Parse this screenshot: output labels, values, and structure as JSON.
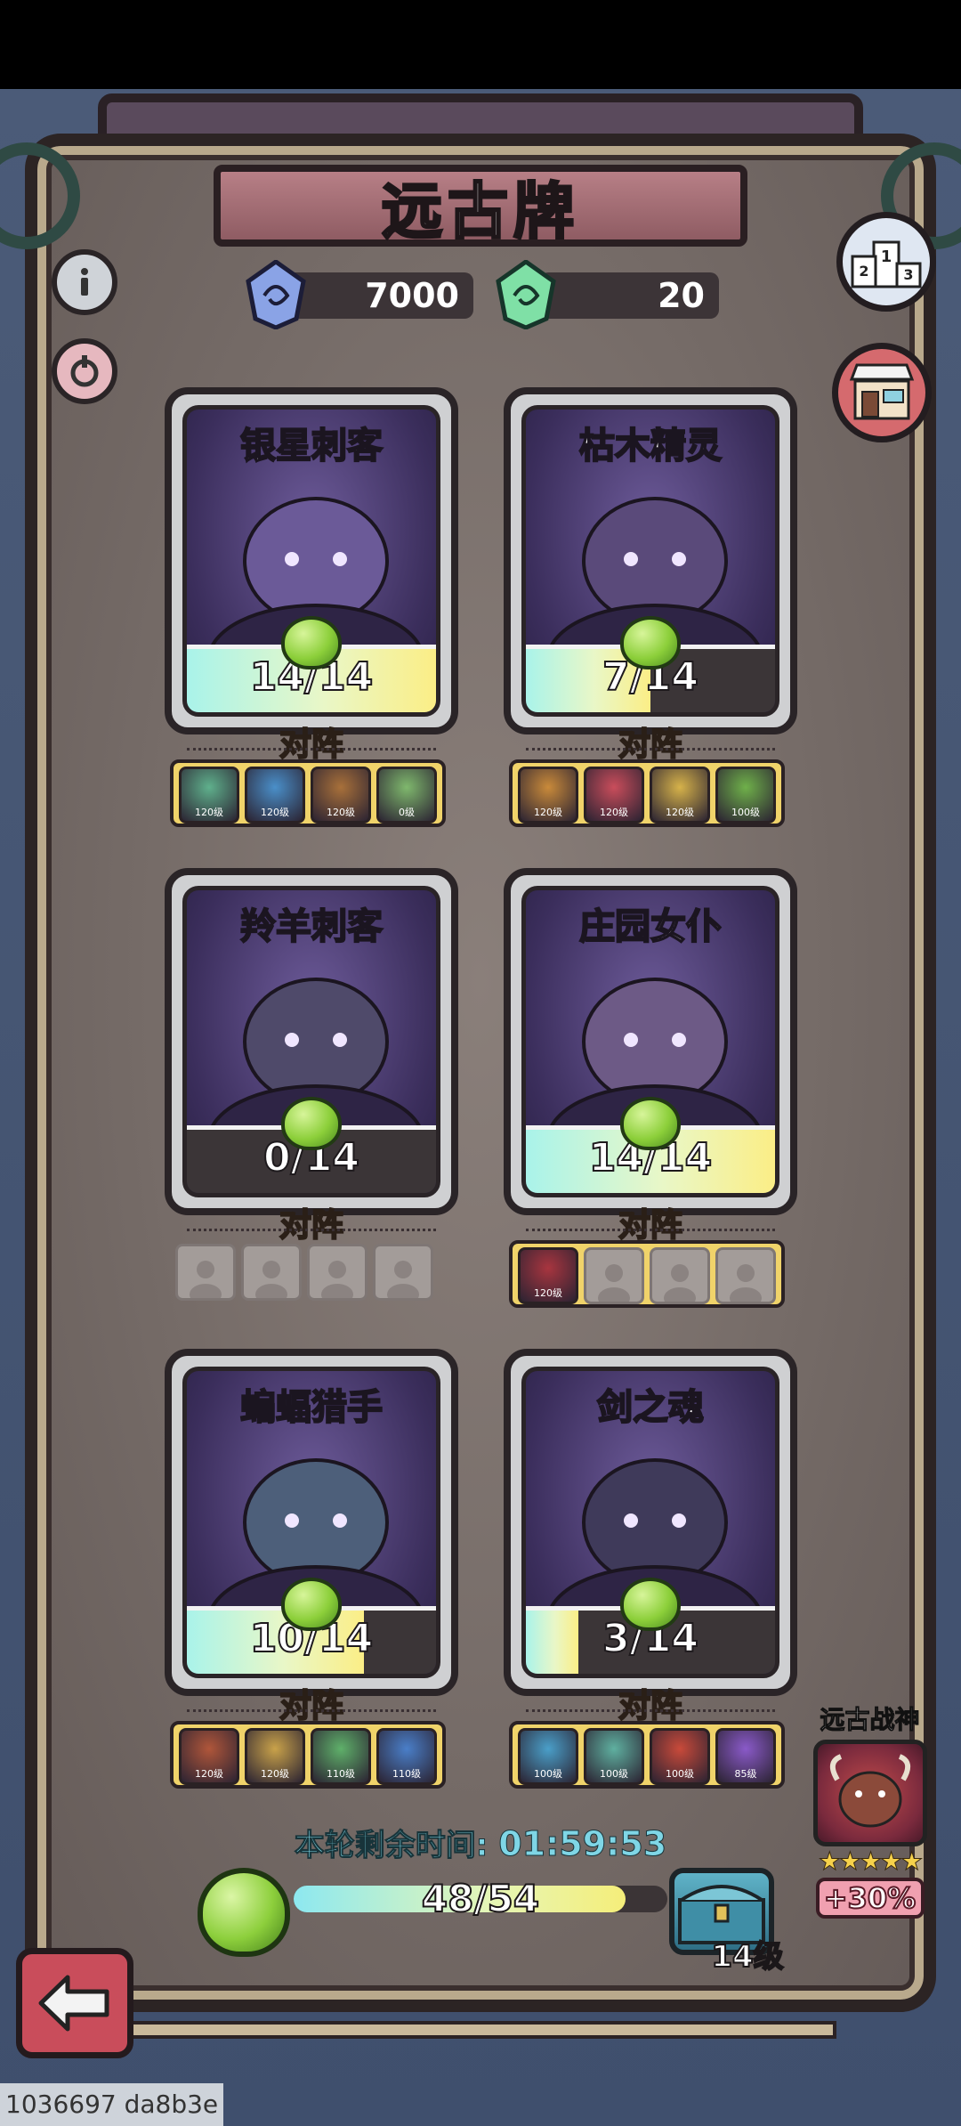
{
  "header": {
    "title": "远古牌"
  },
  "currencies": [
    {
      "icon": "blue-gem-icon",
      "value": "7000"
    },
    {
      "icon": "green-gem-icon",
      "value": "20"
    }
  ],
  "cards": [
    {
      "name": "银星刺客",
      "progress": "14/14",
      "progress_fraction": 1.0,
      "portrait_color": "#6b5a98",
      "opponents_label": "对阵",
      "opponents": [
        {
          "level": "120级",
          "color": "#5fb08c"
        },
        {
          "level": "120级",
          "color": "#4a8fc9"
        },
        {
          "level": "120级",
          "color": "#a8703a"
        },
        {
          "level": "0级",
          "color": "#7fb86d"
        }
      ]
    },
    {
      "name": "枯木精灵",
      "progress": "7/14",
      "progress_fraction": 0.5,
      "portrait_color": "#5a4a7a",
      "opponents_label": "对阵",
      "opponents": [
        {
          "level": "120级",
          "color": "#c98a3a"
        },
        {
          "level": "120级",
          "color": "#c94d5b"
        },
        {
          "level": "120级",
          "color": "#d6b24a"
        },
        {
          "level": "100级",
          "color": "#6fb04a"
        }
      ]
    },
    {
      "name": "羚羊刺客",
      "progress": "0/14",
      "progress_fraction": 0.0,
      "portrait_color": "#4f4a6a",
      "opponents_label": "对阵",
      "opponents": []
    },
    {
      "name": "庄园女仆",
      "progress": "14/14",
      "progress_fraction": 1.0,
      "portrait_color": "#6d5a86",
      "opponents_label": "对阵",
      "opponents": [
        {
          "level": "120级",
          "color": "#a8353f"
        }
      ]
    },
    {
      "name": "蝙蝠猎手",
      "progress": "10/14",
      "progress_fraction": 0.71,
      "portrait_color": "#4d5f7a",
      "opponents_label": "对阵",
      "opponents": [
        {
          "level": "120级",
          "color": "#b0563a"
        },
        {
          "level": "120级",
          "color": "#c9a24a"
        },
        {
          "level": "110级",
          "color": "#5fb06a"
        },
        {
          "level": "110级",
          "color": "#4a7fc9"
        }
      ]
    },
    {
      "name": "剑之魂",
      "progress": "3/14",
      "progress_fraction": 0.21,
      "portrait_color": "#3f3a5a",
      "opponents_label": "对阵",
      "opponents": [
        {
          "level": "100级",
          "color": "#4a9fc9"
        },
        {
          "level": "100级",
          "color": "#5fb0a0"
        },
        {
          "level": "100级",
          "color": "#c94a3a"
        },
        {
          "level": "85级",
          "color": "#8a5ac9"
        }
      ]
    }
  ],
  "timer": {
    "label": "本轮剩余时间:",
    "value": "01:59:53"
  },
  "bottom": {
    "progress": "48/54",
    "progress_fraction": 0.889,
    "level": "14级"
  },
  "ancient_god": {
    "label": "远古战神",
    "stars": "★★★★★",
    "bonus": "+30%"
  },
  "watermark": "1036697 da8b3e"
}
